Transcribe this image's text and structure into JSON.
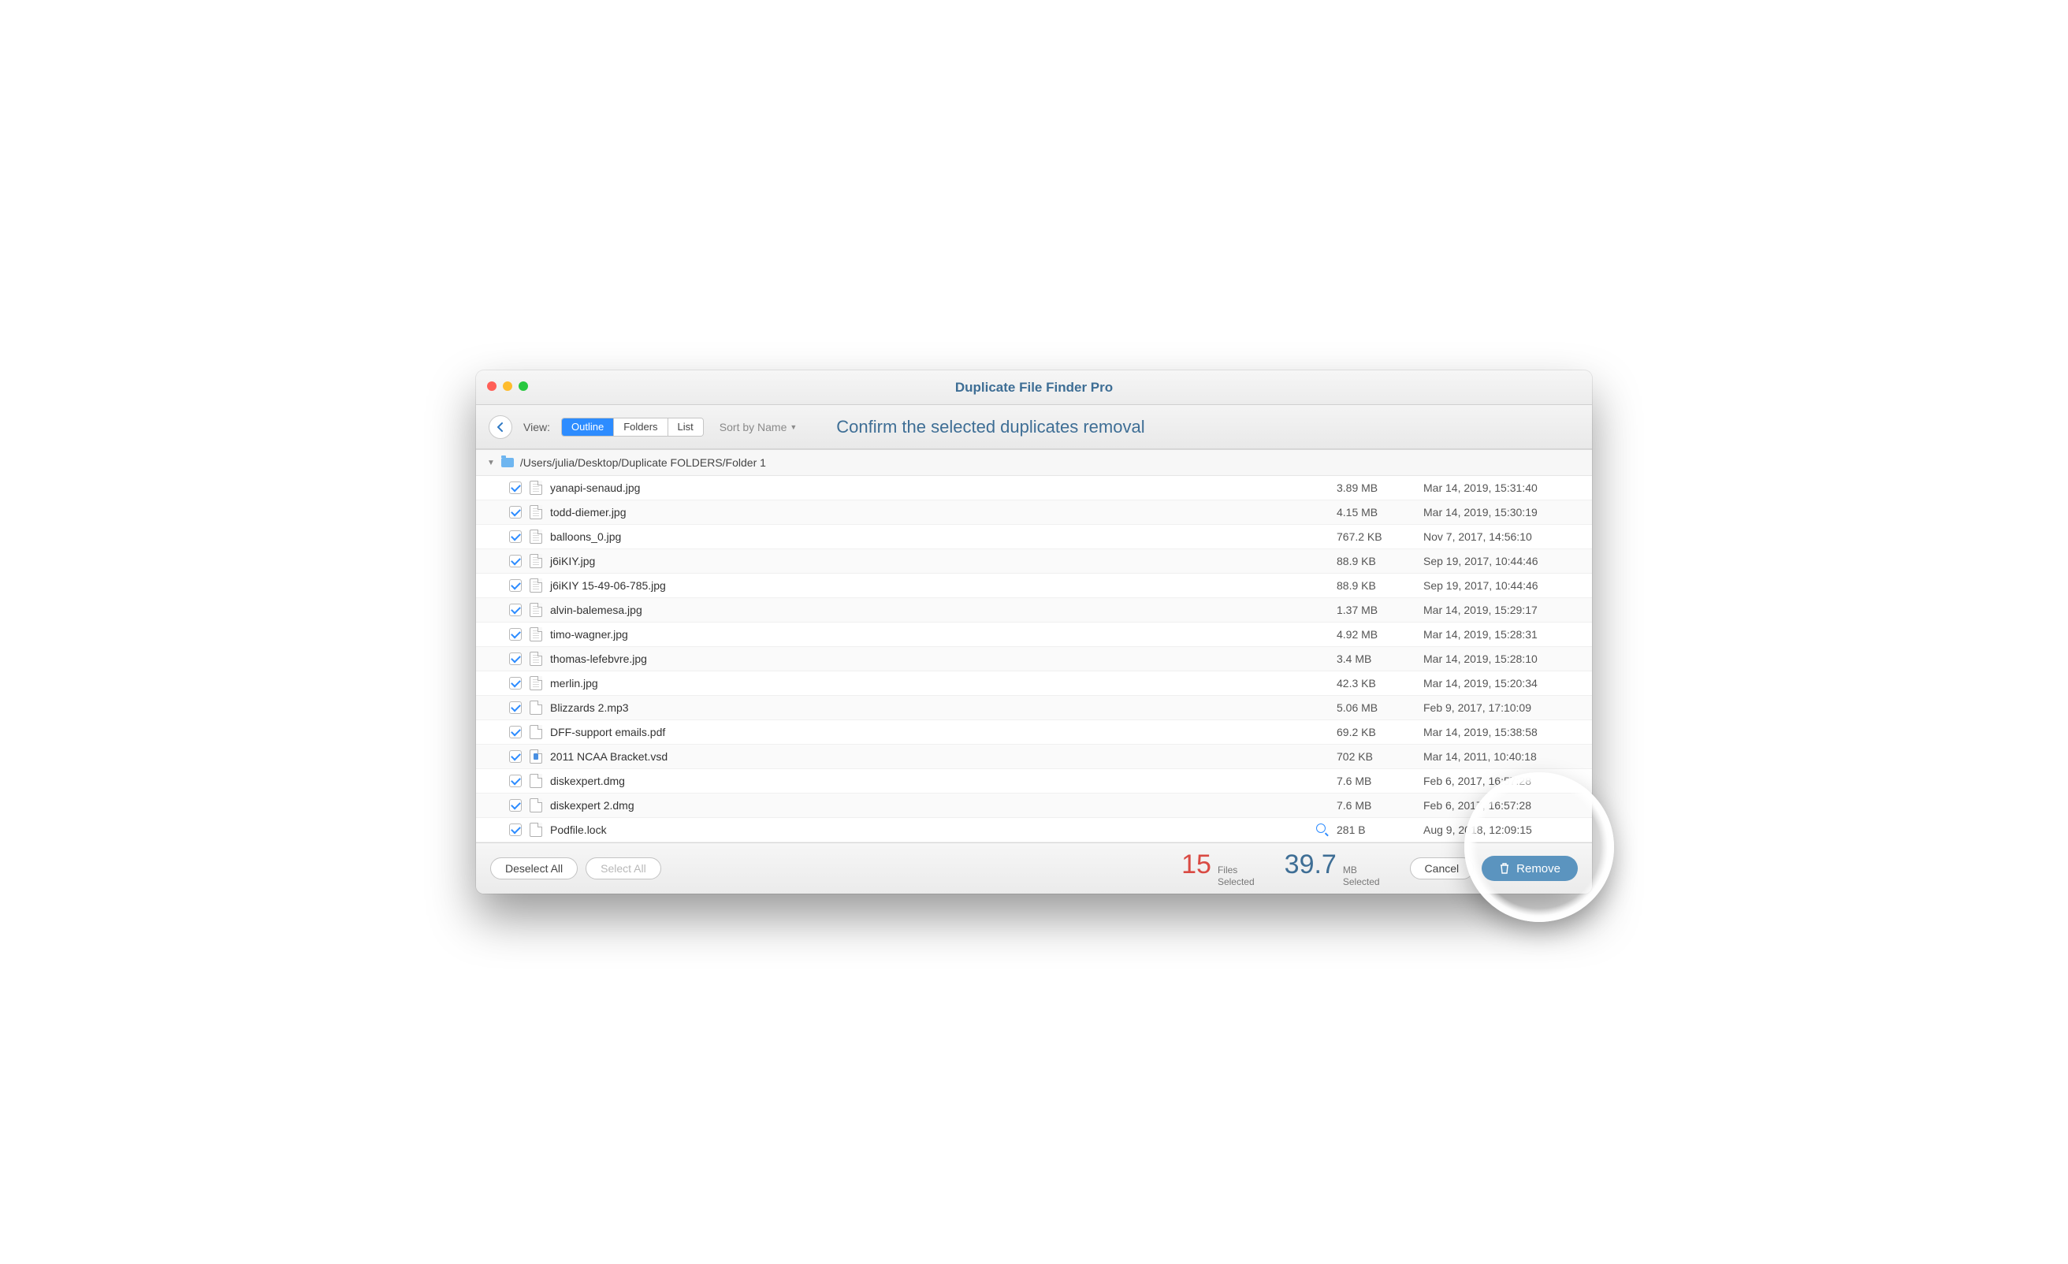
{
  "title": "Duplicate File Finder Pro",
  "toolbar": {
    "view_label": "View:",
    "segments": [
      "Outline",
      "Folders",
      "List"
    ],
    "active_segment": 0,
    "sort_label": "Sort by Name",
    "confirm_heading": "Confirm the selected duplicates removal"
  },
  "folder": {
    "path": "/Users/julia/Desktop/Duplicate FOLDERS/Folder 1"
  },
  "files": [
    {
      "name": "yanapi-senaud.jpg",
      "size": "3.89 MB",
      "date": "Mar 14, 2019, 15:31:40",
      "icon": "img"
    },
    {
      "name": "todd-diemer.jpg",
      "size": "4.15 MB",
      "date": "Mar 14, 2019, 15:30:19",
      "icon": "img"
    },
    {
      "name": "balloons_0.jpg",
      "size": "767.2 KB",
      "date": "Nov 7, 2017, 14:56:10",
      "icon": "img"
    },
    {
      "name": "j6iKIY.jpg",
      "size": "88.9 KB",
      "date": "Sep 19, 2017, 10:44:46",
      "icon": "img"
    },
    {
      "name": "j6iKIY 15-49-06-785.jpg",
      "size": "88.9 KB",
      "date": "Sep 19, 2017, 10:44:46",
      "icon": "img"
    },
    {
      "name": "alvin-balemesa.jpg",
      "size": "1.37 MB",
      "date": "Mar 14, 2019, 15:29:17",
      "icon": "img"
    },
    {
      "name": "timo-wagner.jpg",
      "size": "4.92 MB",
      "date": "Mar 14, 2019, 15:28:31",
      "icon": "img"
    },
    {
      "name": "thomas-lefebvre.jpg",
      "size": "3.4 MB",
      "date": "Mar 14, 2019, 15:28:10",
      "icon": "img"
    },
    {
      "name": "merlin.jpg",
      "size": "42.3 KB",
      "date": "Mar 14, 2019, 15:20:34",
      "icon": "img"
    },
    {
      "name": "Blizzards 2.mp3",
      "size": "5.06 MB",
      "date": "Feb 9, 2017, 17:10:09",
      "icon": "doc"
    },
    {
      "name": "DFF-support emails.pdf",
      "size": "69.2 KB",
      "date": "Mar 14, 2019, 15:38:58",
      "icon": "doc"
    },
    {
      "name": "2011 NCAA Bracket.vsd",
      "size": "702 KB",
      "date": "Mar 14, 2011, 10:40:18",
      "icon": "vsd"
    },
    {
      "name": "diskexpert.dmg",
      "size": "7.6 MB",
      "date": "Feb 6, 2017, 16:57:28",
      "icon": "doc"
    },
    {
      "name": "diskexpert 2.dmg",
      "size": "7.6 MB",
      "date": "Feb 6, 2017, 16:57:28",
      "icon": "doc"
    },
    {
      "name": "Podfile.lock",
      "size": "281 B",
      "date": "Aug 9, 2018, 12:09:15",
      "icon": "doc",
      "mag": true
    }
  ],
  "footer": {
    "deselect": "Deselect All",
    "select": "Select All",
    "files_count": "15",
    "files_label": "Files\nSelected",
    "mb_count": "39.7",
    "mb_label": "MB\nSelected",
    "cancel": "Cancel",
    "remove": "Remove"
  }
}
